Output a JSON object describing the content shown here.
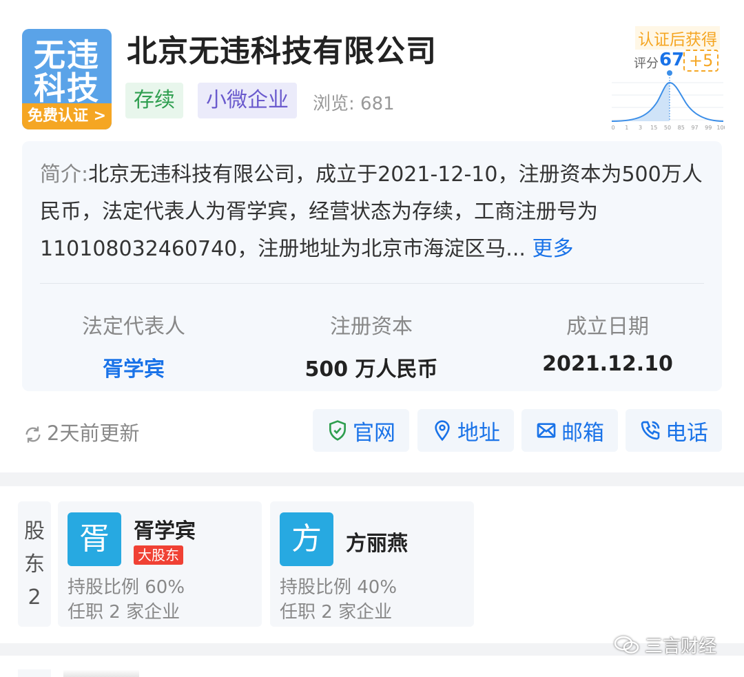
{
  "header": {
    "logo_text_line1": "无违",
    "logo_text_line2": "科技",
    "logo_badge": "免费认证 >",
    "company_name": "北京无违科技有限公司",
    "status_tag": "存续",
    "size_tag": "小微企业",
    "views": "浏览: 681"
  },
  "score": {
    "certify_text": "认证后获得",
    "label": "评分",
    "value": "67",
    "bonus": "+5",
    "axis_ticks": [
      "0",
      "1",
      "3",
      "15",
      "50",
      "85",
      "97",
      "99",
      "100"
    ]
  },
  "intro": {
    "label": "简介:",
    "text": "北京无违科技有限公司，成立于2021-12-10，注册资本为500万人民币，法定代表人为胥学宾，经营状态为存续，工商注册号为110108032460740，注册地址为北京市海淀区马...",
    "more": "更多"
  },
  "stats": {
    "legal_rep_label": "法定代表人",
    "legal_rep_value": "胥学宾",
    "capital_label": "注册资本",
    "capital_value": "500 万人民币",
    "founded_label": "成立日期",
    "founded_value": "2021.12.10"
  },
  "actions": {
    "updated": "2天前更新",
    "website": "官网",
    "address": "地址",
    "email": "邮箱",
    "phone": "电话"
  },
  "shareholders": {
    "label_line1": "股",
    "label_line2": "东",
    "count": "2",
    "items": [
      {
        "avatar": "胥",
        "name": "胥学宾",
        "badge": "大股东",
        "ratio": "持股比例 60%",
        "positions": "任职 2 家企业"
      },
      {
        "avatar": "方",
        "name": "方丽燕",
        "ratio": "持股比例 40%",
        "positions": "任职 2 家企业"
      }
    ]
  },
  "watermark": "三言财经",
  "colors": {
    "primary": "#1a73e8",
    "logo_bg": "#5aa3e8",
    "badge_orange": "#f5a623",
    "status_green": "#2e9e4f",
    "size_purple": "#6a5acd",
    "major_red": "#f04134"
  }
}
